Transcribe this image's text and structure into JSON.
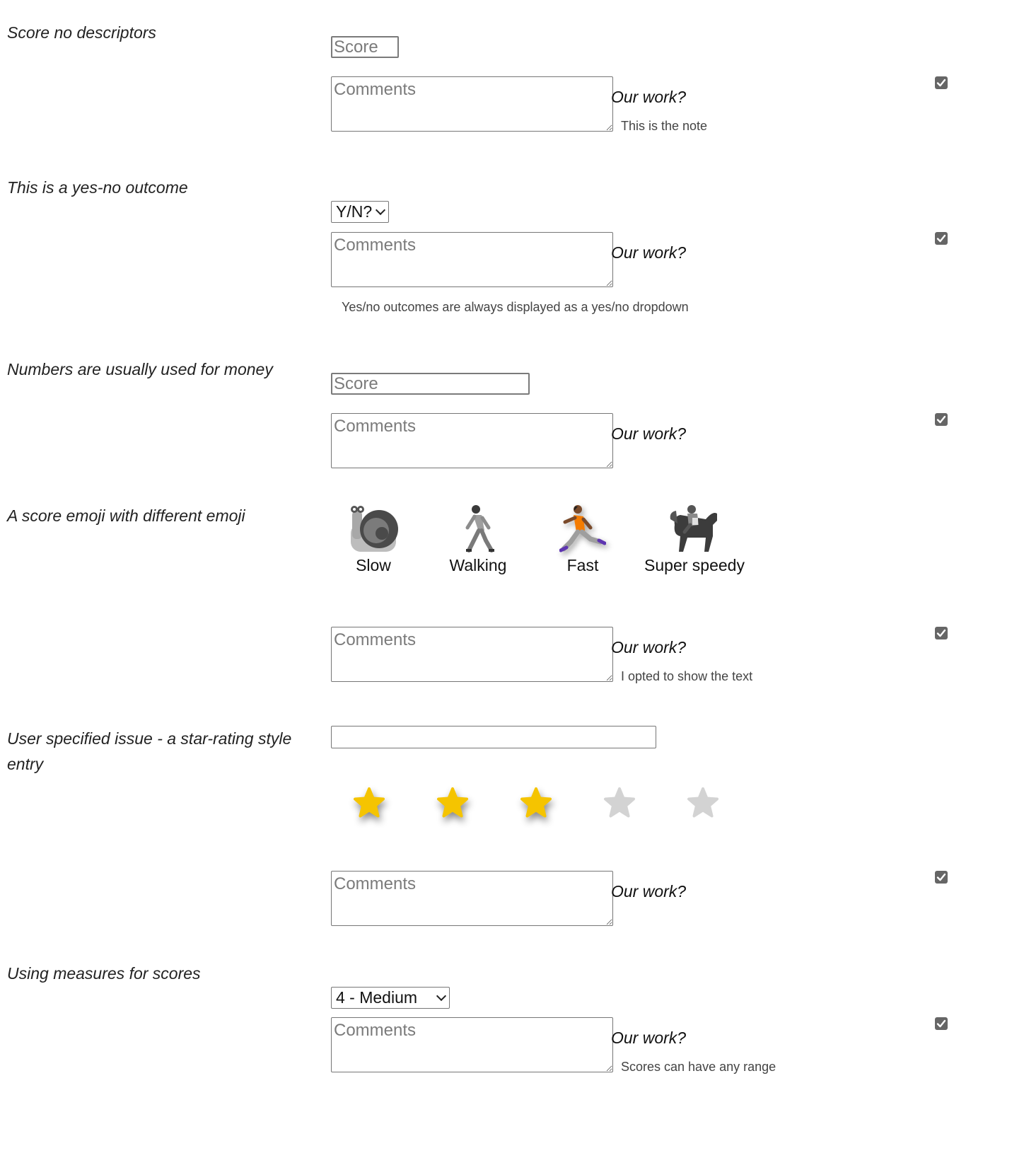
{
  "sections": [
    {
      "label": "Score no descriptors",
      "score_placeholder": "Score",
      "comments_placeholder": "Comments",
      "our_work": "Our work?",
      "note": "This is the note",
      "checked": true
    },
    {
      "label": "This is a yes-no outcome",
      "select_value": "Y/N?",
      "comments_placeholder": "Comments",
      "our_work": "Our work?",
      "note": "Yes/no outcomes are always displayed as a yes/no dropdown",
      "checked": true
    },
    {
      "label": "Numbers are usually used for money",
      "score_placeholder": "Score",
      "comments_placeholder": "Comments",
      "our_work": "Our work?",
      "checked": true
    },
    {
      "label": "A score emoji with different emoji",
      "emoji_options": [
        {
          "label": "Slow",
          "icon": "snail-icon"
        },
        {
          "label": "Walking",
          "icon": "person-walking-icon"
        },
        {
          "label": "Fast",
          "icon": "person-running-icon"
        },
        {
          "label": "Super speedy",
          "icon": "horse-racing-icon"
        }
      ],
      "comments_placeholder": "Comments",
      "our_work": "Our work?",
      "note": "I opted to show the text",
      "checked": true
    },
    {
      "label": "User specified issue - a star-rating style entry",
      "rating": {
        "value": 3,
        "max": 5,
        "filled_color": "#f5c400",
        "empty_color": "#d3d3d3"
      },
      "comments_placeholder": "Comments",
      "our_work": "Our work?",
      "checked": true
    },
    {
      "label": "Using measures for scores",
      "select_value": "4 - Medium",
      "comments_placeholder": "Comments",
      "our_work": "Our work?",
      "note": "Scores can have any range",
      "checked": true
    }
  ]
}
